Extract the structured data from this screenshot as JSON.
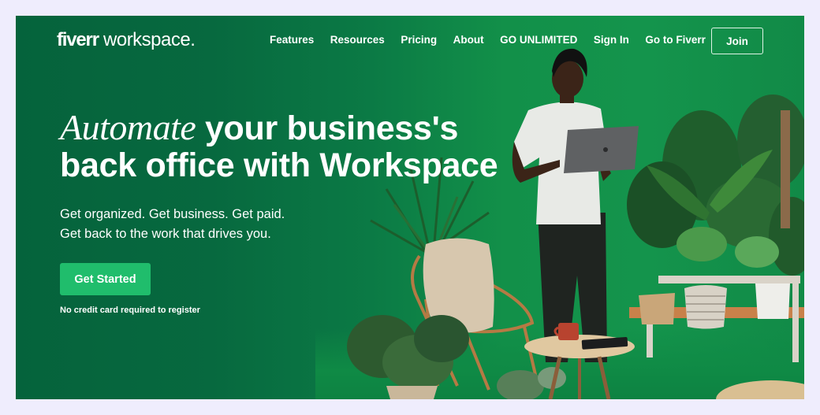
{
  "brand": {
    "logo_bold": "fiverr",
    "logo_light": " workspace."
  },
  "nav": {
    "items": [
      {
        "label": "Features"
      },
      {
        "label": "Resources"
      },
      {
        "label": "Pricing"
      },
      {
        "label": "About"
      },
      {
        "label": "GO UNLIMITED"
      },
      {
        "label": "Sign In"
      },
      {
        "label": "Go to Fiverr"
      }
    ],
    "join_label": "Join"
  },
  "hero": {
    "headline_italic": "Automate",
    "headline_rest_line1": " your business's",
    "headline_line2": "back office with Workspace",
    "subtitle_line1": "Get organized. Get business. Get paid.",
    "subtitle_line2": "Get back to the work that drives you.",
    "cta_label": "Get Started",
    "cta_note": "No credit card required to register"
  },
  "scene": {
    "image_description": "Man in white t-shirt holding a laptop, surrounded by houseplants, a rattan chair with sheepskin, a round side table with a red mug and tablet, and a woven pouf",
    "colors": {
      "accent_green": "#20bd6c",
      "bg_dark_green": "#05633c",
      "bg_bright_green": "#14944c",
      "page_bg": "#efedfd"
    }
  }
}
